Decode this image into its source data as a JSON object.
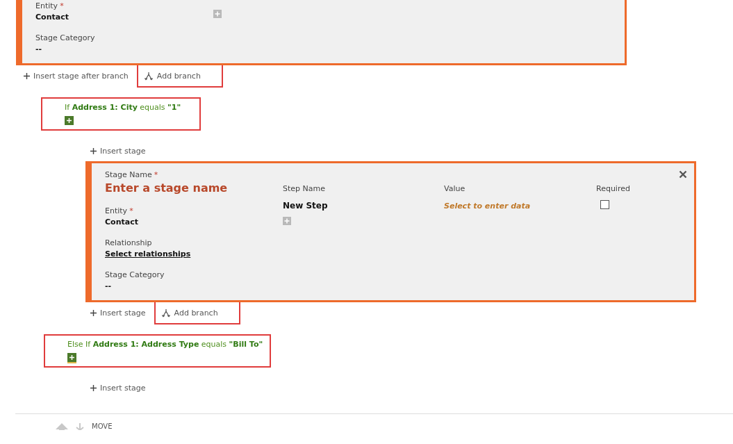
{
  "flow": [
    {
      "kind": "stage",
      "fields": [
        {
          "label": "Entity",
          "required_mark": "*",
          "value": "Contact",
          "kind": "text"
        },
        {
          "label": "Stage Category",
          "value": "--",
          "kind": "text"
        }
      ]
    },
    {
      "kind": "actions",
      "items": [
        {
          "kind": "insert",
          "label": "Insert stage after branch",
          "highlighted": false
        },
        {
          "kind": "branch",
          "label": "Add branch",
          "highlighted": true
        }
      ]
    },
    {
      "kind": "condition",
      "text": "If **Address 1: City** equals **\"1\"**",
      "highlighted": true,
      "add_focused": false,
      "children": [
        {
          "kind": "actions",
          "items": [
            {
              "kind": "insert",
              "label": "Insert stage",
              "highlighted": false
            }
          ]
        },
        {
          "kind": "stage",
          "closable": true,
          "stage_name": {
            "label": "Stage Name",
            "required_mark": "*",
            "placeholder": "Enter a stage name"
          },
          "fields": [
            {
              "label": "Entity",
              "required_mark": "*",
              "value": "Contact",
              "kind": "text"
            },
            {
              "label": "Relationship",
              "value": "Select relationships",
              "kind": "link"
            },
            {
              "label": "Stage Category",
              "value": "--",
              "kind": "text"
            }
          ],
          "columns": [
            "Step Name",
            "Value",
            "Required"
          ],
          "steps": [
            {
              "name": "New Step",
              "value": "Select to enter data",
              "required": false
            }
          ]
        },
        {
          "kind": "actions",
          "items": [
            {
              "kind": "insert",
              "label": "Insert stage",
              "highlighted": false
            },
            {
              "kind": "branch",
              "label": "Add branch",
              "highlighted": true
            }
          ]
        }
      ]
    },
    {
      "kind": "condition",
      "text": "Else If **Address 1: Address Type** equals **\"Bill To\"**",
      "highlighted": true,
      "add_focused": true,
      "children": [
        {
          "kind": "actions",
          "items": [
            {
              "kind": "insert",
              "label": "Insert stage",
              "highlighted": false
            }
          ]
        }
      ]
    }
  ],
  "toolbar": {
    "label": "MOVE"
  }
}
